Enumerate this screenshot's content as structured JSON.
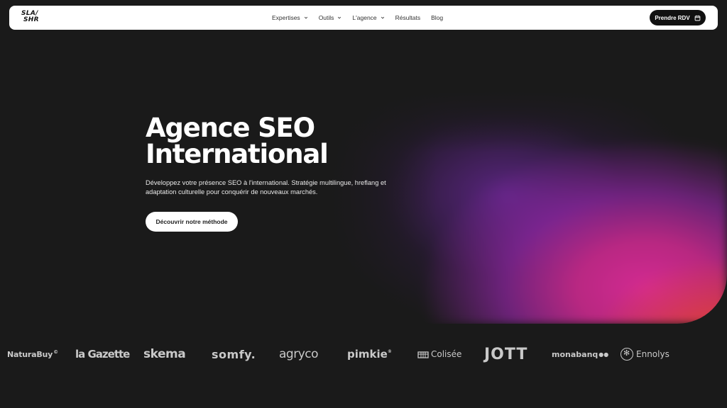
{
  "brand": {
    "logo_line1": "SLA/",
    "logo_line2": "SHR"
  },
  "nav": {
    "items": [
      {
        "label": "Expertises",
        "has_dropdown": true
      },
      {
        "label": "Outils",
        "has_dropdown": true
      },
      {
        "label": "L'agence",
        "has_dropdown": true
      },
      {
        "label": "Résultats",
        "has_dropdown": false
      },
      {
        "label": "Blog",
        "has_dropdown": false
      }
    ],
    "cta_label": "Prendre RDV",
    "cta_icon": "calendar-icon"
  },
  "hero": {
    "title_line1": "Agence SEO",
    "title_line2": "International",
    "description": "Développez votre présence SEO à l'international. Stratégie multilingue, hreflang et adaptation culturelle pour conquérir de nouveaux marchés.",
    "button_label": "Découvrir notre méthode"
  },
  "clients": [
    {
      "name": "NaturaBuy"
    },
    {
      "name": "la Gazette"
    },
    {
      "name": "skema"
    },
    {
      "name": "somfy."
    },
    {
      "name": "agryco"
    },
    {
      "name": "pimkie"
    },
    {
      "name": "Colisée"
    },
    {
      "name": "JOTT"
    },
    {
      "name": "monabanq"
    },
    {
      "name": "Ennolys"
    }
  ],
  "colors": {
    "background": "#1a1a1a",
    "navbar": "#ffffff",
    "cta_bg": "#111111",
    "gradient_purple": "#7a2aa8",
    "gradient_pink": "#d32a92",
    "gradient_orange": "#e8452a"
  }
}
